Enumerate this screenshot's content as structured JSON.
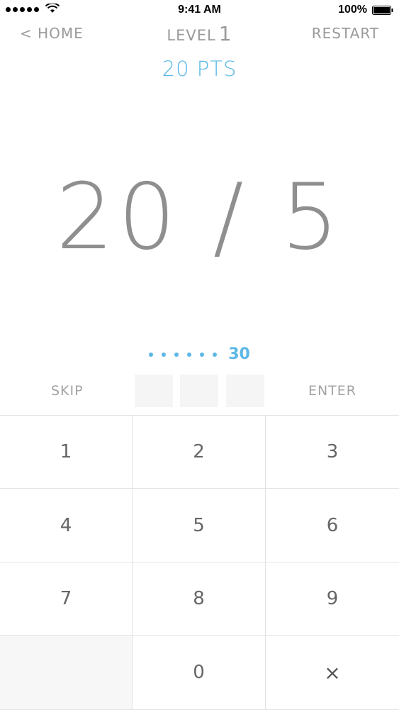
{
  "status_bar": {
    "time": "9:41 AM",
    "battery": "100%"
  },
  "header": {
    "home_label": "< HOME",
    "level_word": "LEVEL",
    "level_number": "1",
    "restart_label": "RESTART"
  },
  "points": "20 PTS",
  "problem": {
    "left": "20",
    "operator": "/",
    "right": "5"
  },
  "timer": {
    "dots_remaining": 6,
    "count": "30",
    "accent_color": "#5bb8e6"
  },
  "answer": {
    "skip_label": "SKIP",
    "enter_label": "ENTER"
  },
  "keypad": {
    "keys": [
      "1",
      "2",
      "3",
      "4",
      "5",
      "6",
      "7",
      "8",
      "9",
      "",
      "0",
      "×"
    ]
  }
}
